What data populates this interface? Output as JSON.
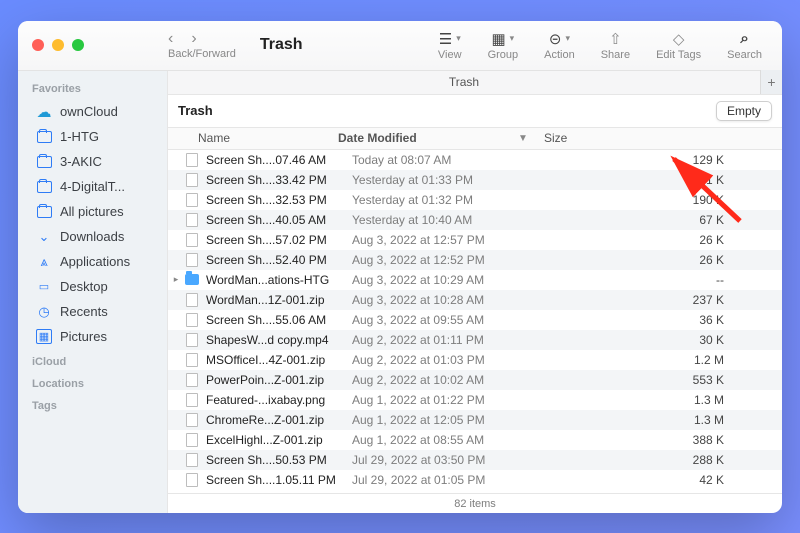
{
  "toolbar": {
    "back_forward_label": "Back/Forward",
    "title": "Trash",
    "items": [
      {
        "id": "view",
        "label": "View",
        "active": true
      },
      {
        "id": "group",
        "label": "Group",
        "active": true
      },
      {
        "id": "action",
        "label": "Action",
        "active": true
      },
      {
        "id": "share",
        "label": "Share",
        "active": false
      },
      {
        "id": "tags",
        "label": "Edit Tags",
        "active": false
      },
      {
        "id": "search",
        "label": "Search",
        "active": true
      }
    ]
  },
  "sidebar": {
    "sections": [
      {
        "header": "Favorites",
        "items": [
          {
            "icon": "cloud",
            "label": "ownCloud",
            "cls": "owncloud"
          },
          {
            "icon": "folder",
            "label": "1-HTG"
          },
          {
            "icon": "folder",
            "label": "3-AKIC"
          },
          {
            "icon": "folder",
            "label": "4-DigitalT..."
          },
          {
            "icon": "folder",
            "label": "All pictures"
          },
          {
            "icon": "download",
            "label": "Downloads"
          },
          {
            "icon": "apps",
            "label": "Applications"
          },
          {
            "icon": "desktop",
            "label": "Desktop"
          },
          {
            "icon": "clock",
            "label": "Recents"
          },
          {
            "icon": "pictures",
            "label": "Pictures"
          }
        ]
      },
      {
        "header": "iCloud",
        "items": []
      },
      {
        "header": "Locations",
        "items": []
      },
      {
        "header": "Tags",
        "items": []
      }
    ]
  },
  "tab": {
    "label": "Trash",
    "newtab": "+"
  },
  "location": {
    "name": "Trash",
    "empty_btn": "Empty"
  },
  "columns": {
    "name": "Name",
    "date": "Date Modified",
    "size": "Size",
    "sort": "desc"
  },
  "rows": [
    {
      "kind": "file",
      "name": "Screen Sh....07.46 AM",
      "date": "Today at 08:07 AM",
      "size": "129 K"
    },
    {
      "kind": "file",
      "name": "Screen Sh....33.42 PM",
      "date": "Yesterday at 01:33 PM",
      "size": "191 K"
    },
    {
      "kind": "file",
      "name": "Screen Sh....32.53 PM",
      "date": "Yesterday at 01:32 PM",
      "size": "190 K"
    },
    {
      "kind": "file",
      "name": "Screen Sh....40.05 AM",
      "date": "Yesterday at 10:40 AM",
      "size": "67 K"
    },
    {
      "kind": "file",
      "name": "Screen Sh....57.02 PM",
      "date": "Aug 3, 2022 at 12:57 PM",
      "size": "26 K"
    },
    {
      "kind": "file",
      "name": "Screen Sh....52.40 PM",
      "date": "Aug 3, 2022 at 12:52 PM",
      "size": "26 K"
    },
    {
      "kind": "folder",
      "name": "WordMan...ations-HTG",
      "date": "Aug 3, 2022 at 10:29 AM",
      "size": "--",
      "expand": true
    },
    {
      "kind": "file",
      "name": "WordMan...1Z-001.zip",
      "date": "Aug 3, 2022 at 10:28 AM",
      "size": "237 K"
    },
    {
      "kind": "file",
      "name": "Screen Sh....55.06 AM",
      "date": "Aug 3, 2022 at 09:55 AM",
      "size": "36 K"
    },
    {
      "kind": "file",
      "name": "ShapesW...d copy.mp4",
      "date": "Aug 2, 2022 at 01:11 PM",
      "size": "30 K"
    },
    {
      "kind": "file",
      "name": "MSOfficeI...4Z-001.zip",
      "date": "Aug 2, 2022 at 01:03 PM",
      "size": "1.2 M"
    },
    {
      "kind": "file",
      "name": "PowerPoin...Z-001.zip",
      "date": "Aug 2, 2022 at 10:02 AM",
      "size": "553 K"
    },
    {
      "kind": "file",
      "name": "Featured-...ixabay.png",
      "date": "Aug 1, 2022 at 01:22 PM",
      "size": "1.3 M"
    },
    {
      "kind": "file",
      "name": "ChromeRe...Z-001.zip",
      "date": "Aug 1, 2022 at 12:05 PM",
      "size": "1.3 M"
    },
    {
      "kind": "file",
      "name": "ExcelHighl...Z-001.zip",
      "date": "Aug 1, 2022 at 08:55 AM",
      "size": "388 K"
    },
    {
      "kind": "file",
      "name": "Screen Sh....50.53 PM",
      "date": "Jul 29, 2022 at 03:50 PM",
      "size": "288 K"
    },
    {
      "kind": "file",
      "name": "Screen Sh....1.05.11 PM",
      "date": "Jul 29, 2022 at 01:05 PM",
      "size": "42 K"
    }
  ],
  "status": "82 items"
}
